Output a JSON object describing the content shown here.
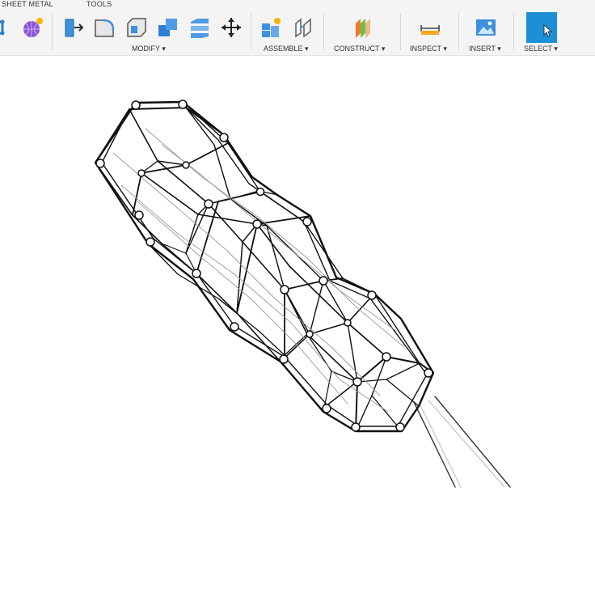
{
  "tabs": {
    "sheet_metal": "SHEET METAL",
    "tools": "TOOLS"
  },
  "groups": {
    "modify": "MODIFY ▾",
    "assemble": "ASSEMBLE ▾",
    "construct": "CONSTRUCT ▾",
    "inspect": "INSPECT ▾",
    "insert": "INSERT ▾",
    "select": "SELECT ▾"
  },
  "icons": [
    "sketch-line-icon",
    "form-sphere-icon",
    "press-pull-icon",
    "fillet-icon",
    "shell-icon",
    "combine-icon",
    "split-body-icon",
    "move-icon",
    "new-component-icon",
    "joint-icon",
    "offset-plane-icon",
    "measure-icon",
    "insert-image-icon",
    "select-icon"
  ],
  "colors": {
    "accent": "#1d8fd6",
    "toolbar_bg": "#f4f4f4",
    "wire": "#111111"
  }
}
